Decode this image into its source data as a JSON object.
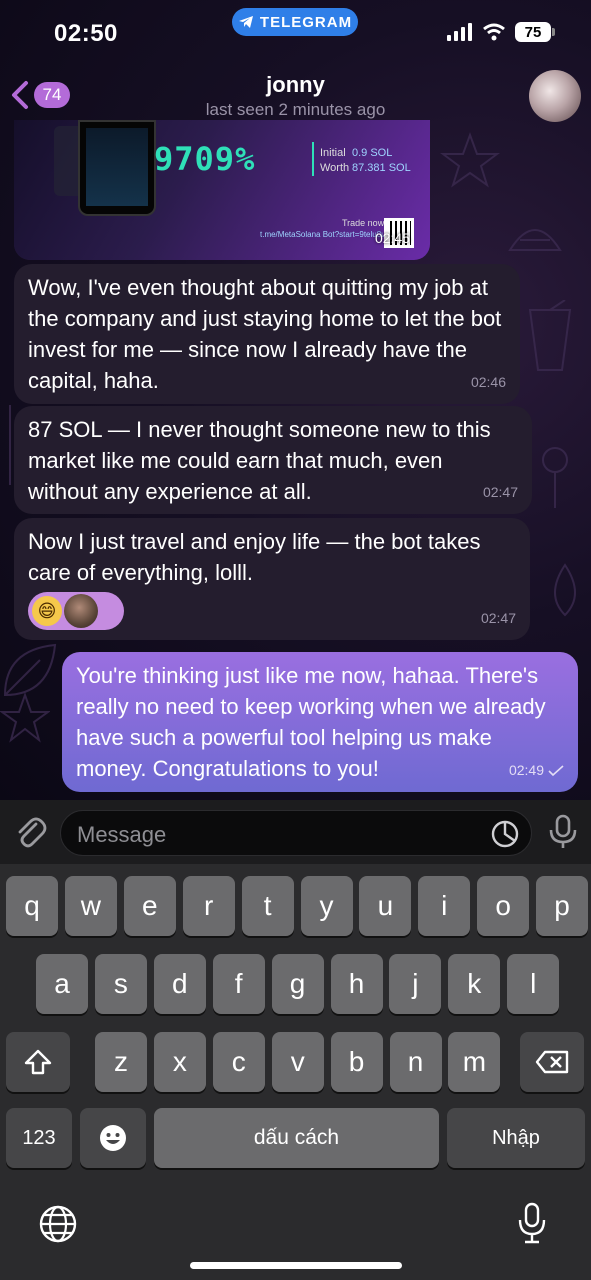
{
  "status_bar": {
    "time": "02:50",
    "app_pill": "TELEGRAM",
    "battery": "75"
  },
  "header": {
    "back_count": "74",
    "name": "jonny",
    "status": "last seen 2 minutes ago"
  },
  "image_message": {
    "percent": "9709%",
    "initial_label": "Initial",
    "initial_value": "0.9 SOL",
    "worth_label": "Worth",
    "worth_value": "87.381 SOL",
    "trade_now": "Trade now",
    "link": "t.me/MetaSolana Bot?start=9telu8u",
    "time": "02:45"
  },
  "messages": [
    {
      "text": "Wow, I've even thought about quitting my job at the company and just staying home to let the bot invest for me — since now I already have the capital, haha.",
      "time": "02:46"
    },
    {
      "text": "87 SOL — I never thought someone new to this market like me could earn that much, even without any experience at all.",
      "time": "02:47"
    },
    {
      "text": "Now I just travel and enjoy life — the bot takes care of everything, lolll.",
      "time": "02:47",
      "reaction": "😄"
    },
    {
      "text": "You're thinking just like me now, hahaa. There's really no need to keep working when we already have such a powerful tool helping us make money. Congratulations to you!",
      "time": "02:49"
    }
  ],
  "input": {
    "placeholder": "Message"
  },
  "keyboard": {
    "row1": [
      "q",
      "w",
      "e",
      "r",
      "t",
      "y",
      "u",
      "i",
      "o",
      "p"
    ],
    "row2": [
      "a",
      "s",
      "d",
      "f",
      "g",
      "h",
      "j",
      "k",
      "l"
    ],
    "row3": [
      "z",
      "x",
      "c",
      "v",
      "b",
      "n",
      "m"
    ],
    "numbers": "123",
    "space": "dấu cách",
    "return": "Nhập"
  },
  "colors": {
    "accent": "#b36bd8",
    "outgoing_bubble": "#8a6ddc",
    "incoming_bubble": "#241d2e",
    "telegram_blue": "#2f7fe8"
  }
}
